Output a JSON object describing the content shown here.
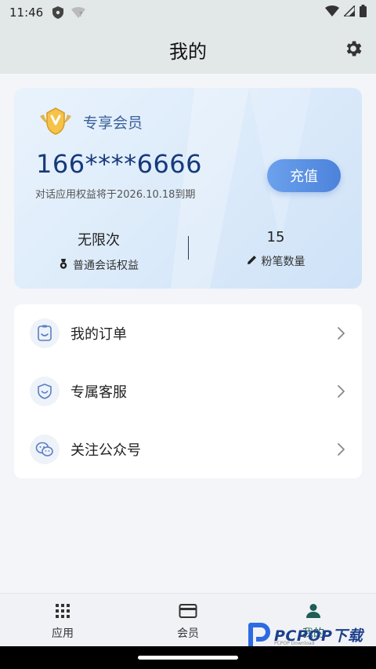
{
  "status_bar": {
    "time": "11:46"
  },
  "header": {
    "title": "我的"
  },
  "vip_card": {
    "title": "专享会员",
    "phone": "166****6666",
    "expiry_text": "对话应用权益将于2026.10.18到期",
    "recharge_label": "充值",
    "stats": [
      {
        "value": "无限次",
        "label": "普通会话权益"
      },
      {
        "value": "15",
        "label": "粉笔数量"
      }
    ]
  },
  "menu": {
    "items": [
      {
        "label": "我的订单"
      },
      {
        "label": "专属客服"
      },
      {
        "label": "关注公众号"
      }
    ]
  },
  "bottom_nav": {
    "tabs": [
      {
        "label": "应用"
      },
      {
        "label": "会员"
      },
      {
        "label": "我的"
      }
    ]
  },
  "watermark": {
    "text": "PCPOP下载",
    "sub": "PCPOP Download"
  },
  "colors": {
    "accent": "#4c82db",
    "active_tab": "#1d5e56",
    "card_blue": "#163a7a"
  }
}
